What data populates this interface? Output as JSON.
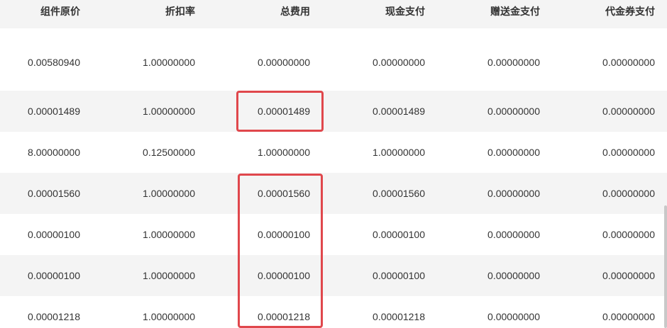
{
  "table": {
    "columns": [
      "组件原价",
      "折扣率",
      "总费用",
      "现金支付",
      "赠送金支付",
      "代金券支付"
    ],
    "rows": [
      [
        "0.00580940",
        "1.00000000",
        "0.00000000",
        "0.00000000",
        "0.00000000",
        "0.00000000"
      ],
      [
        "0.00001489",
        "1.00000000",
        "0.00001489",
        "0.00001489",
        "0.00000000",
        "0.00000000"
      ],
      [
        "8.00000000",
        "0.12500000",
        "1.00000000",
        "1.00000000",
        "0.00000000",
        "0.00000000"
      ],
      [
        "0.00001560",
        "1.00000000",
        "0.00001560",
        "0.00001560",
        "0.00000000",
        "0.00000000"
      ],
      [
        "0.00000100",
        "1.00000000",
        "0.00000100",
        "0.00000100",
        "0.00000000",
        "0.00000000"
      ],
      [
        "0.00000100",
        "1.00000000",
        "0.00000100",
        "0.00000100",
        "0.00000000",
        "0.00000000"
      ],
      [
        "0.00001218",
        "1.00000000",
        "0.00001218",
        "0.00001218",
        "0.00000000",
        "0.00000000"
      ]
    ]
  },
  "colors": {
    "highlight": "#e0474c",
    "stripe": "#f4f4f4",
    "text": "#333333"
  }
}
